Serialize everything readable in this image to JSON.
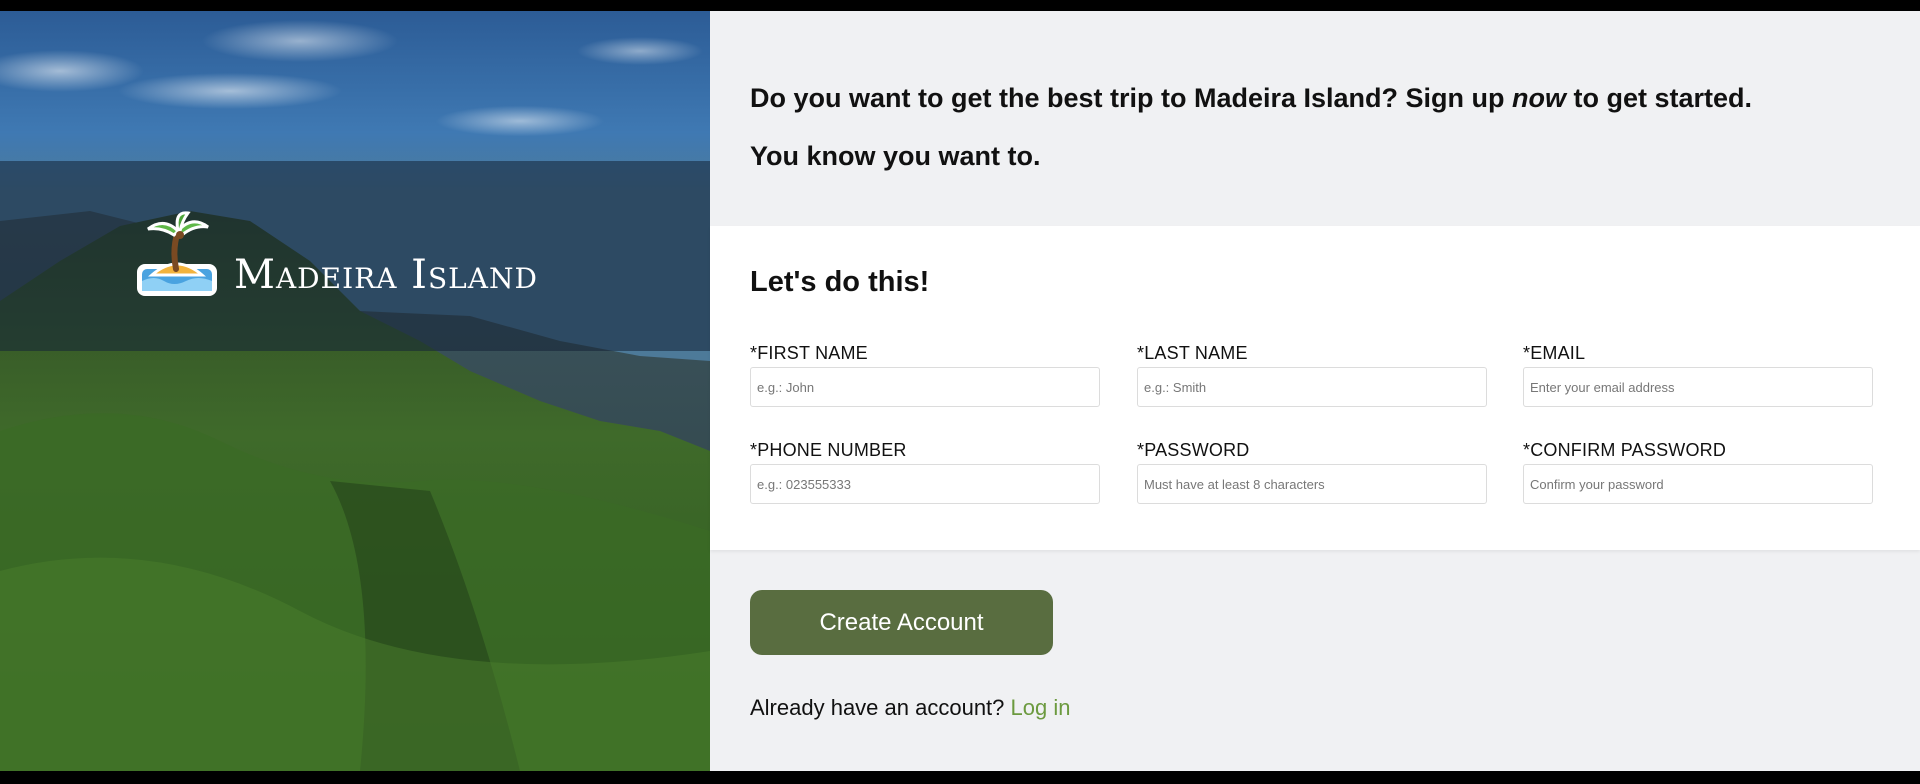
{
  "brand": {
    "name": "Madeira Island",
    "icon": "palm-island-icon"
  },
  "intro": {
    "line1_before": "Do you want to get the best trip to Madeira Island? Sign up ",
    "line1_emphasis": "now",
    "line1_after": " to get started.",
    "line2": "You know you want to."
  },
  "form": {
    "title": "Let's do this!",
    "fields": [
      {
        "label": "*FIRST NAME",
        "placeholder": "e.g.: John"
      },
      {
        "label": "*LAST NAME",
        "placeholder": "e.g.: Smith"
      },
      {
        "label": "*EMAIL",
        "placeholder": "Enter your email address"
      },
      {
        "label": "*PHONE NUMBER",
        "placeholder": "e.g.: 023555333"
      },
      {
        "label": "*PASSWORD",
        "placeholder": "Must have at least 8 characters"
      },
      {
        "label": "*CONFIRM PASSWORD",
        "placeholder": "Confirm your password"
      }
    ]
  },
  "actions": {
    "create_label": "Create Account",
    "login_prompt": "Already have an account?",
    "login_link": "Log in"
  },
  "colors": {
    "accent": "#596d40",
    "link": "#6c9a3f",
    "panel_bg": "#f0f1f3"
  }
}
